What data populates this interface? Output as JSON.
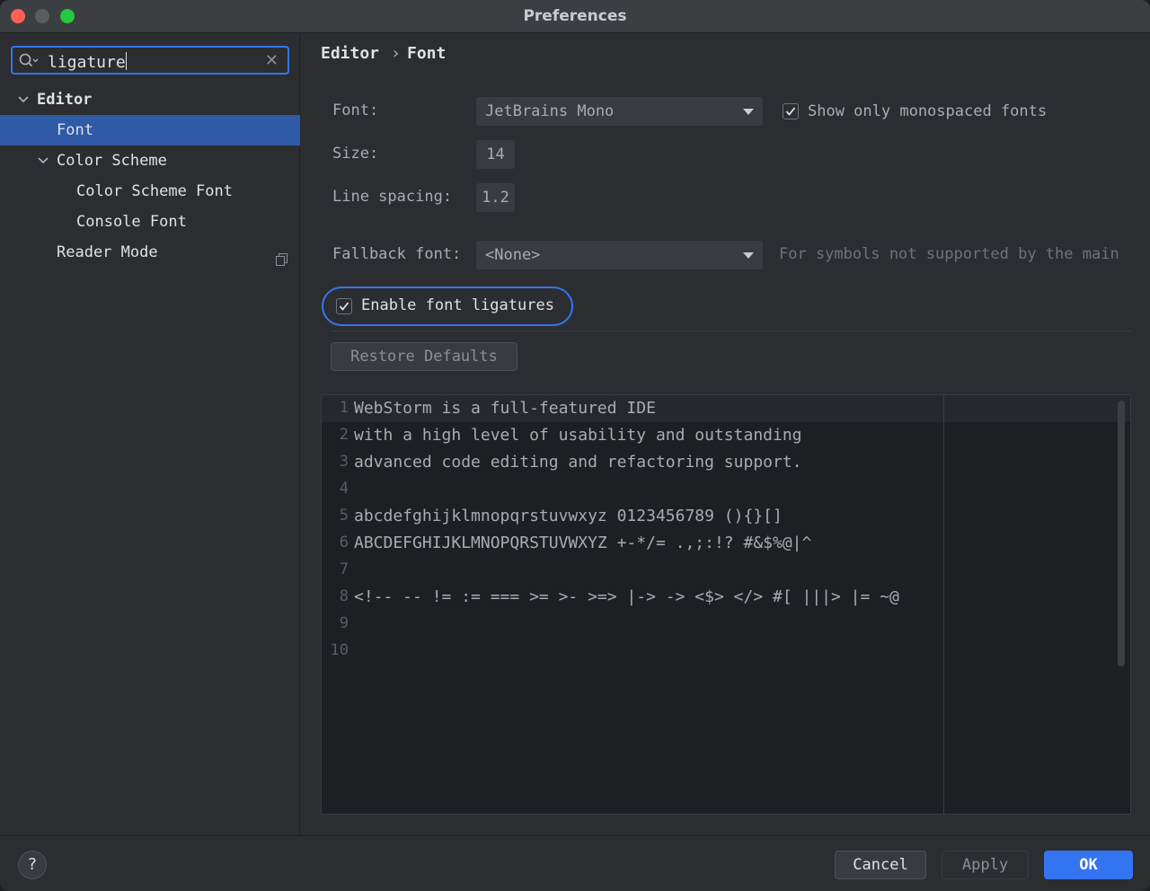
{
  "window": {
    "title": "Preferences"
  },
  "search": {
    "value": "ligature"
  },
  "tree": {
    "editor": "Editor",
    "font": "Font",
    "color_scheme": "Color Scheme",
    "color_scheme_font": "Color Scheme Font",
    "console_font": "Console Font",
    "reader_mode": "Reader Mode"
  },
  "breadcrumb": {
    "parent": "Editor",
    "separator": "›",
    "current": "Font"
  },
  "form": {
    "font_label": "Font:",
    "font_value": "JetBrains Mono",
    "monospaced_label": "Show only monospaced fonts",
    "monospaced_checked": true,
    "size_label": "Size:",
    "size_value": "14",
    "line_spacing_label": "Line spacing:",
    "line_spacing_value": "1.2",
    "fallback_label": "Fallback font:",
    "fallback_value": "<None>",
    "fallback_hint": "For symbols not supported by the main",
    "ligatures_label": "Enable font ligatures",
    "ligatures_checked": true,
    "restore_label": "Restore Defaults"
  },
  "preview": {
    "lines": [
      {
        "n": "1",
        "text": "WebStorm is a full-featured IDE"
      },
      {
        "n": "2",
        "text": "with a high level of usability and outstanding"
      },
      {
        "n": "3",
        "text": "advanced code editing and refactoring support."
      },
      {
        "n": "4",
        "text": ""
      },
      {
        "n": "5",
        "text": "abcdefghijklmnopqrstuvwxyz 0123456789 (){}[]"
      },
      {
        "n": "6",
        "text": "ABCDEFGHIJKLMNOPQRSTUVWXYZ +-*/= .,;:!? #&$%@|^"
      },
      {
        "n": "7",
        "text": ""
      },
      {
        "n": "8",
        "text": "<!-- -- != := === >= >- >=> |-> -> <$> </> #[ |||> |= ~@"
      },
      {
        "n": "9",
        "text": ""
      },
      {
        "n": "10",
        "text": ""
      }
    ]
  },
  "footer": {
    "help": "?",
    "cancel": "Cancel",
    "apply": "Apply",
    "ok": "OK"
  },
  "colors": {
    "accent": "#3574f0",
    "background": "#2b2d30",
    "editor_bg": "#1e1f22",
    "selection": "#2e5aa6"
  }
}
